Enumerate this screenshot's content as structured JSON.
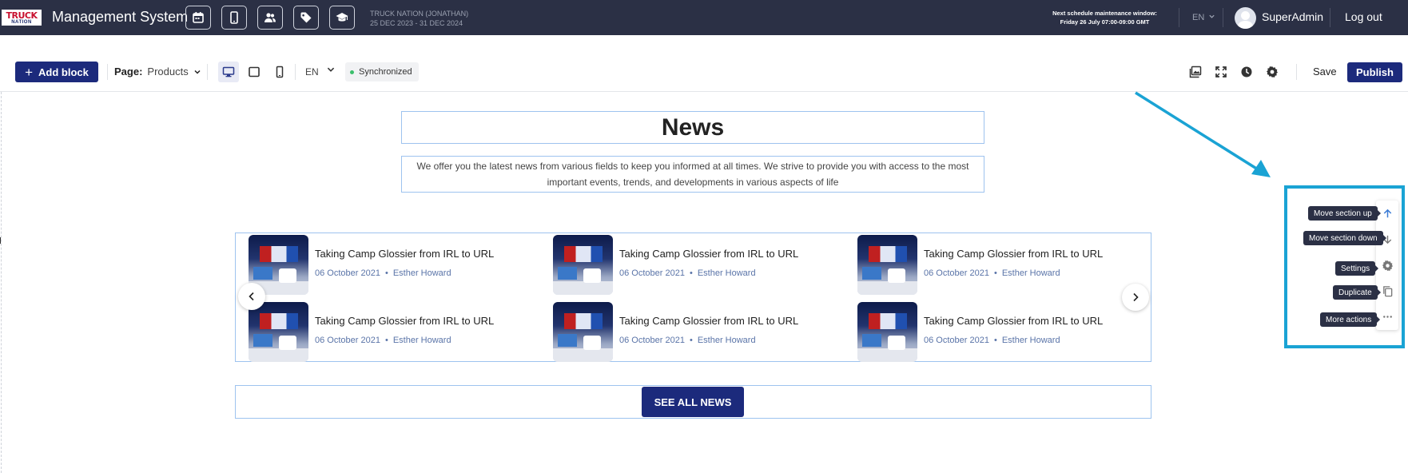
{
  "topbar": {
    "logo_line1": "TRUCK",
    "logo_line2": "NATION",
    "app_title": "Management System",
    "nav_icons": [
      "calendar-icon",
      "mobile-icon",
      "users-icon",
      "tag-icon",
      "graduation-cap-icon"
    ],
    "tenant_name": "TRUCK NATION (JONATHAN)",
    "tenant_dates": "25 DEC 2023 - 31 DEC 2024",
    "maintenance_label": "Next schedule maintenance window:",
    "maintenance_time": "Friday 26 July 07:00-09:00 GMT",
    "language": "EN",
    "username": "SuperAdmin",
    "logout": "Log out"
  },
  "toolbar": {
    "add_block": "Add block",
    "page_label": "Page:",
    "page_value": "Products",
    "language": "EN",
    "sync_status": "Synchronized",
    "save": "Save",
    "publish": "Publish"
  },
  "section": {
    "title": "News",
    "description": "We offer you the latest news from various fields to keep you informed at all times. We strive to provide you with access to the most important events, trends, and developments in various aspects of life",
    "articles": [
      {
        "title": "Taking Camp Glossier from IRL to URL",
        "date": "06 October 2021",
        "author": "Esther Howard"
      },
      {
        "title": "Taking Camp Glossier from IRL to URL",
        "date": "06 October 2021",
        "author": "Esther Howard"
      },
      {
        "title": "Taking Camp Glossier from IRL to URL",
        "date": "06 October 2021",
        "author": "Esther Howard"
      },
      {
        "title": "Taking Camp Glossier from IRL to URL",
        "date": "06 October 2021",
        "author": "Esther Howard"
      },
      {
        "title": "Taking Camp Glossier from IRL to URL",
        "date": "06 October 2021",
        "author": "Esther Howard"
      },
      {
        "title": "Taking Camp Glossier from IRL to URL",
        "date": "06 October 2021",
        "author": "Esther Howard"
      }
    ],
    "bullet": "•",
    "see_all": "SEE ALL NEWS"
  },
  "section_actions": {
    "move_up": "Move section up",
    "move_down": "Move section down",
    "settings": "Settings",
    "duplicate": "Duplicate",
    "more": "More actions"
  },
  "colors": {
    "topbar_bg": "#2b3045",
    "primary": "#1c2a7c",
    "selection_outline": "#9ec3ef",
    "annotation": "#1aa3d4",
    "sync_dot": "#3bbf6c"
  }
}
